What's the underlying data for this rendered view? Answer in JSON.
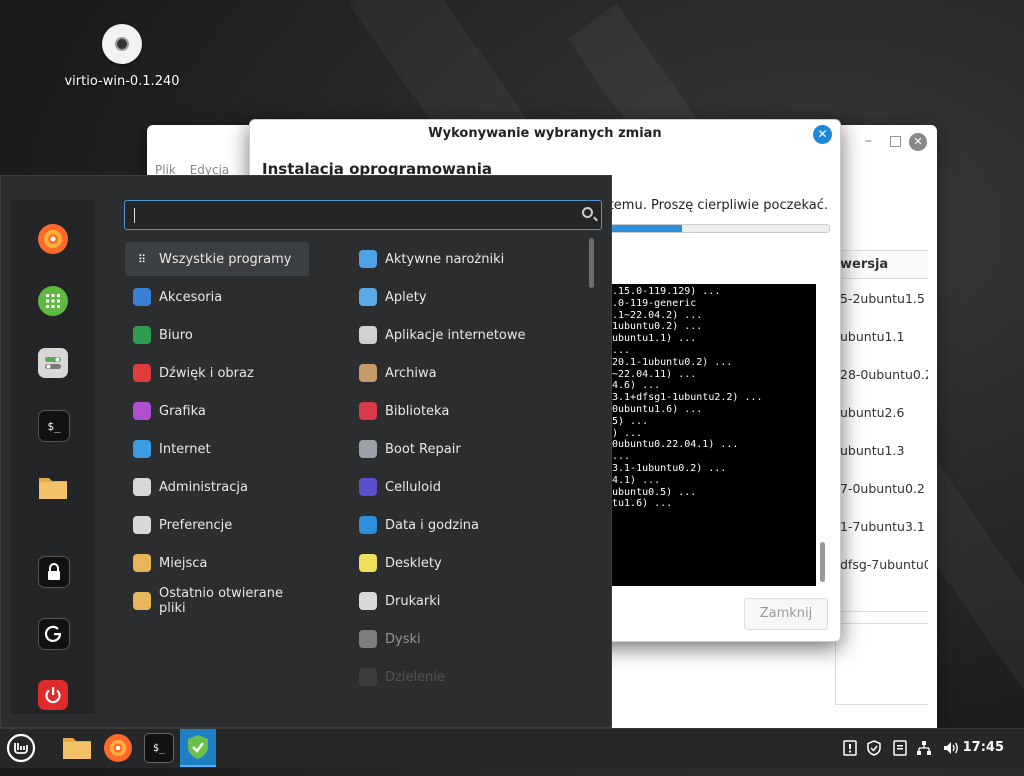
{
  "desktop": {
    "icon_label": "virtio-win-0.1.240"
  },
  "bg_window": {
    "menu": [
      "Plik",
      "Edycja"
    ],
    "column_header": "wersja",
    "rows": [
      "5-2ubuntu1.5",
      "ubuntu1.1",
      "28-0ubuntu0.2",
      "ubuntu2.6",
      "ubuntu1.3",
      "7-0ubuntu0.2",
      "1-7ubuntu3.1",
      "dfsg-7ubuntu0."
    ]
  },
  "dialog": {
    "title": "Wykonywanie wybranych zmian",
    "heading": "Instalacja oprogramowania",
    "message": "systemu. Proszę cierpliwie poczekać.",
    "progress": 0.74,
    "terminal_lines": [
      ".15.0-119.129) ...",
      "",
      ".0-119-generic",
      "",
      ".1~22.04.2) ...",
      "1ubuntu0.2) ...",
      "ubuntu1.1) ...",
      "...",
      "20.1-1ubuntu0.2) ...",
      "~22.04.11) ...",
      "4.6) ...",
      "3.1+dfsg1-1ubuntu2.2) ...",
      "0ubuntu1.6) ...",
      "5) ...",
      ") ...",
      "0ubuntu0.22.04.1) ...",
      "...",
      "3.1-1ubuntu0.2) ...",
      "4.1) ...",
      "ubuntu0.5) ...",
      "tu1.6) ..."
    ],
    "close_button": "Zamknij"
  },
  "menu": {
    "search_placeholder": "",
    "categories": [
      {
        "label": "Wszystkie programy",
        "icon": "grid-icon",
        "color": "#3c3f42"
      },
      {
        "label": "Akcesoria",
        "icon": "scissors-icon",
        "color": "#3a7fd5"
      },
      {
        "label": "Biuro",
        "icon": "office-icon",
        "color": "#2e9b4e"
      },
      {
        "label": "Dźwięk i obraz",
        "icon": "play-icon",
        "color": "#e23b3b"
      },
      {
        "label": "Grafika",
        "icon": "palette-icon",
        "color": "#b04fd0"
      },
      {
        "label": "Internet",
        "icon": "cloud-icon",
        "color": "#3a9be0"
      },
      {
        "label": "Administracja",
        "icon": "admin-icon",
        "color": "#d8d8d8"
      },
      {
        "label": "Preferencje",
        "icon": "preferences-icon",
        "color": "#d8d8d8"
      },
      {
        "label": "Miejsca",
        "icon": "folder-icon",
        "color": "#e8b65a"
      },
      {
        "label": "Ostatnio otwierane pliki",
        "icon": "recent-folder-icon",
        "color": "#e8b65a"
      }
    ],
    "apps": [
      {
        "label": "Aktywne narożniki",
        "icon": "hot-corners-icon",
        "color": "#4ea3e8"
      },
      {
        "label": "Aplety",
        "icon": "applets-icon",
        "color": "#5aa8e6"
      },
      {
        "label": "Aplikacje internetowe",
        "icon": "web-apps-icon",
        "color": "#d0d0d0"
      },
      {
        "label": "Archiwa",
        "icon": "archive-icon",
        "color": "#c79a6a"
      },
      {
        "label": "Biblioteka",
        "icon": "library-icon",
        "color": "#d83a4a"
      },
      {
        "label": "Boot Repair",
        "icon": "boot-repair-icon",
        "color": "#9aa0a8"
      },
      {
        "label": "Celluloid",
        "icon": "celluloid-icon",
        "color": "#5a4fcf"
      },
      {
        "label": "Data i godzina",
        "icon": "clock-icon",
        "color": "#2e8fdc"
      },
      {
        "label": "Desklety",
        "icon": "desklets-icon",
        "color": "#f0e05a"
      },
      {
        "label": "Drukarki",
        "icon": "printer-icon",
        "color": "#d8d8d8"
      },
      {
        "label": "Dyski",
        "icon": "disks-icon",
        "color": "#c0c0c0"
      },
      {
        "label": "Dzielenie",
        "icon": "share-icon",
        "color": "#777777"
      }
    ],
    "favorites": [
      {
        "name": "firefox-icon",
        "color": "#ff6a2b",
        "glyph": "◉"
      },
      {
        "name": "software-manager-icon",
        "color": "#6cc04a",
        "glyph": "▦"
      },
      {
        "name": "settings-icon",
        "color": "#d8d8d8",
        "glyph": "◧"
      },
      {
        "name": "terminal-icon",
        "color": "#111111",
        "glyph": "$_"
      },
      {
        "name": "files-icon",
        "color": "#f0c060",
        "glyph": ""
      },
      {
        "name": "lock-icon",
        "color": "#111111",
        "glyph": "🔒"
      },
      {
        "name": "logout-icon",
        "color": "#111111",
        "glyph": "⟳"
      },
      {
        "name": "power-icon",
        "color": "#e02b2b",
        "glyph": "⏻"
      }
    ]
  },
  "taskbar": {
    "clock": "17:45"
  }
}
